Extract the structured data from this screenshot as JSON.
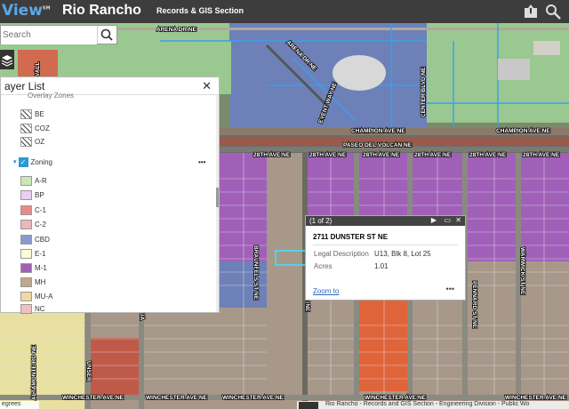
{
  "header": {
    "logo_text": "View",
    "logo_tm": "SM",
    "city": "Rio Rancho",
    "subtitle": "Records & GIS Section"
  },
  "search": {
    "placeholder": "Search"
  },
  "layer_list": {
    "title": "ayer List",
    "items": [
      {
        "label": "Overlay Zones",
        "swatch": "hatch"
      },
      {
        "label": "BE",
        "swatch": "hatch"
      },
      {
        "label": "COZ",
        "swatch": "hatch"
      },
      {
        "label": "OZ",
        "swatch": "hatch"
      },
      {
        "label": "Zoning",
        "swatch": "check"
      },
      {
        "label": "A-R",
        "swatch": "#c8e8b8"
      },
      {
        "label": "BP",
        "swatch": "#e8d0f0"
      },
      {
        "label": "C-1",
        "swatch": "#e88a8a"
      },
      {
        "label": "C-2",
        "swatch": "#e8b8b8"
      },
      {
        "label": "CBD",
        "swatch": "#8a9ad0"
      },
      {
        "label": "E-1",
        "swatch": "#fbfbd8"
      },
      {
        "label": "M-1",
        "swatch": "#a060b8"
      },
      {
        "label": "MH",
        "swatch": "#c0a888"
      },
      {
        "label": "MU-A",
        "swatch": "#f0d8a0"
      },
      {
        "label": "NC",
        "swatch": "#f0c0c0"
      }
    ],
    "more_label": "•••"
  },
  "popup": {
    "header": "(1 of 2)",
    "address": "2711 DUNSTER ST NE",
    "fields": [
      {
        "key": "Legal Description",
        "value": "U13, Blk 8, Lot 25"
      },
      {
        "key": "Acres",
        "value": "1.01"
      }
    ],
    "zoom_label": "Zoom to",
    "more_label": "•••"
  },
  "map_labels": {
    "arena_top": "ARENA DR NE",
    "arena_diag": "ARENA DR NE",
    "event_way": "EVENT WAY NE",
    "center_blvd": "CENTER BLVD NE",
    "champion_left": "CHAMPION AVE NE",
    "champion_right": "CHAMPION AVE NE",
    "paseo": "PASEO DEL VOLCAN NE",
    "ave28": "28TH AVE NE",
    "braunfels": "BRAUNFELS ST NE",
    "dunster": "DUNSTER ST NE",
    "pennard": "PENNARD ST NE",
    "warwick": "WARWICK ST NE",
    "altamonte": "ALTAMONTE RD NE",
    "winchester": "WINCHESTER AVE NE",
    "unser": "UNSER",
    "ja": "JA",
    "vall": "VALL"
  },
  "footer": {
    "attribution": "Rio Rancho - Records and GIS Section - Engineering Division - Public Wo",
    "degrees": "egrees"
  },
  "colors": {
    "header_bg": "#3d3d3d",
    "m1_purple": "#a060b8",
    "ar_green": "#c8e8b8",
    "cbd_blue": "#8a9ad0",
    "e1_yellow": "#fbfbd8"
  }
}
